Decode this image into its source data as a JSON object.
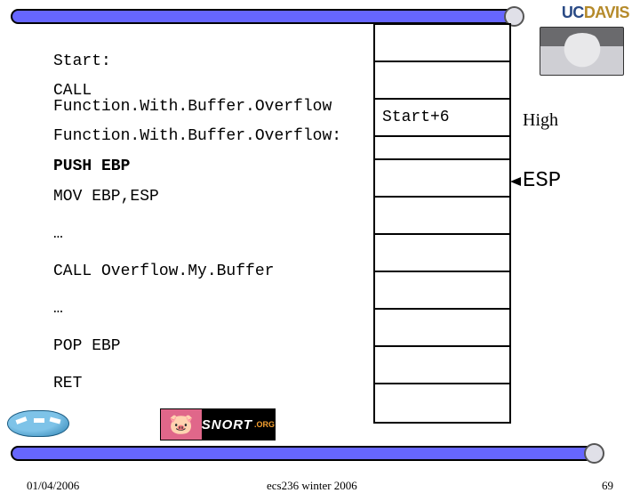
{
  "logo": {
    "uc": "UC",
    "davis": "DAVIS"
  },
  "code": {
    "l1": "Start:",
    "l2": "CALL Function.With.Buffer.Overflow",
    "l3": "Function.With.Buffer.Overflow:",
    "l4": "PUSH EBP",
    "l5": "MOV EBP,ESP",
    "l6": "…",
    "l7": "CALL Overflow.My.Buffer",
    "l8": "…",
    "l9": "POP EBP",
    "l10": "RET"
  },
  "stack": {
    "cells": [
      "",
      "",
      "Start+6",
      "",
      "",
      "",
      "",
      "",
      "",
      "",
      ""
    ]
  },
  "annot": {
    "high": "High",
    "esp": "ESP"
  },
  "snort": {
    "label": "SNORT",
    "org": ".ORG"
  },
  "footer": {
    "date": "01/04/2006",
    "course": "ecs236 winter 2006",
    "page": "69"
  }
}
